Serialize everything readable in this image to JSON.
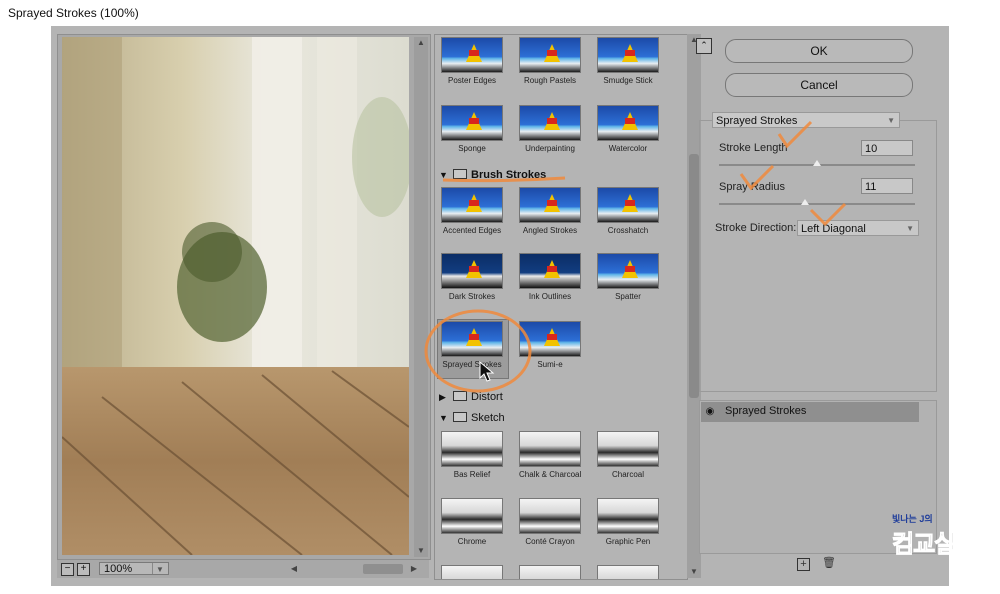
{
  "window": {
    "title": "Sprayed Strokes (100%)"
  },
  "preview": {
    "zoom": "100%",
    "zoom_out": "−",
    "zoom_in": "+"
  },
  "gallery": {
    "top_row1": [
      "Poster Edges",
      "Rough Pastels",
      "Smudge Stick"
    ],
    "top_row2": [
      "Sponge",
      "Underpainting",
      "Watercolor"
    ],
    "brush_strokes": {
      "label": "Brush Strokes",
      "row1": [
        "Accented Edges",
        "Angled Strokes",
        "Crosshatch"
      ],
      "row2": [
        "Dark Strokes",
        "Ink Outlines",
        "Spatter"
      ],
      "row3": [
        "Sprayed Strokes",
        "Sumi-e"
      ]
    },
    "distort": {
      "label": "Distort"
    },
    "sketch": {
      "label": "Sketch",
      "row1": [
        "Bas Relief",
        "Chalk & Charcoal",
        "Charcoal"
      ],
      "row2": [
        "Chrome",
        "Conté Crayon",
        "Graphic Pen"
      ]
    }
  },
  "buttons": {
    "ok": "OK",
    "cancel": "Cancel"
  },
  "settings": {
    "filter": "Sprayed Strokes",
    "stroke_length_label": "Stroke Length",
    "stroke_length": "10",
    "spray_radius_label": "Spray Radius",
    "spray_radius": "11",
    "direction_label": "Stroke Direction:",
    "direction": "Left Diagonal"
  },
  "layers": {
    "active": "Sprayed Strokes"
  },
  "watermark": {
    "top": "빛나는 J의",
    "main": "컴교실"
  }
}
